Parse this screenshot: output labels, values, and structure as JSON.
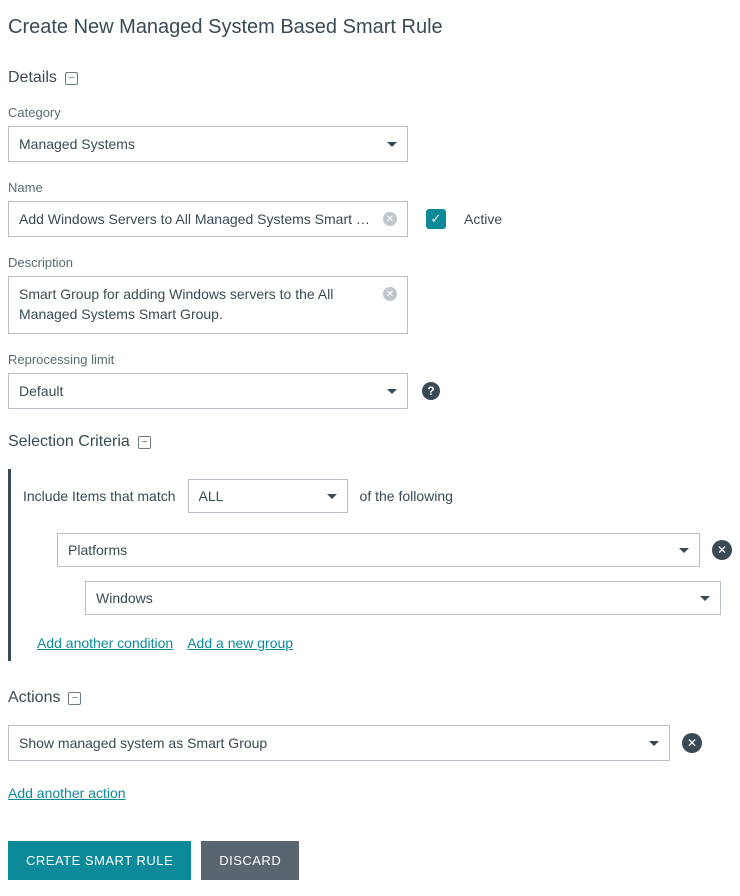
{
  "page_title": "Create New Managed System Based Smart Rule",
  "sections": {
    "details": {
      "header": "Details",
      "category": {
        "label": "Category",
        "value": "Managed Systems"
      },
      "name": {
        "label": "Name",
        "value": "Add Windows Servers to All Managed Systems Smart Group"
      },
      "active": {
        "label": "Active",
        "checked": true
      },
      "description": {
        "label": "Description",
        "value": "Smart Group for adding Windows servers to the All Managed Systems Smart Group."
      },
      "reprocessing": {
        "label": "Reprocessing limit",
        "value": "Default"
      }
    },
    "criteria": {
      "header": "Selection Criteria",
      "include_prefix": "Include Items that match",
      "match_value": "ALL",
      "include_suffix": "of the following",
      "platform_label": "Platforms",
      "platform_value": "Windows",
      "add_condition": "Add another condition",
      "add_group": "Add a new group"
    },
    "actions": {
      "header": "Actions",
      "action_value": "Show managed system as Smart Group",
      "add_action": "Add another action"
    }
  },
  "buttons": {
    "create": "CREATE SMART RULE",
    "discard": "DISCARD"
  }
}
